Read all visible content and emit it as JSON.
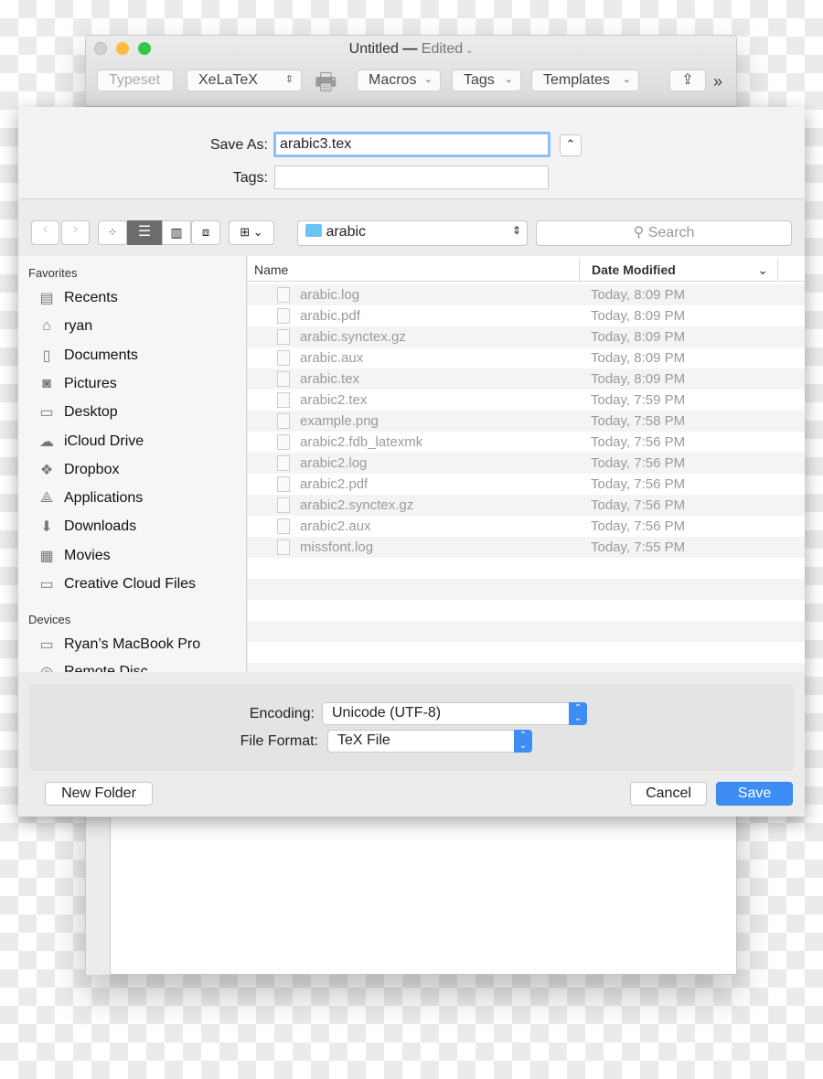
{
  "window": {
    "title": "Untitled",
    "title_sep": "—",
    "edited": "Edited",
    "toolbar": {
      "typeset": "Typeset",
      "engine": "XeLaTeX",
      "macros": "Macros",
      "tags": "Tags",
      "templates": "Templates",
      "overflow": "»"
    }
  },
  "dialog": {
    "save_as_label": "Save As:",
    "save_as_value": "arabic3.tex",
    "tags_label": "Tags:",
    "tags_value": "",
    "location": "arabic",
    "search_placeholder": "Search",
    "sidebar": {
      "favorites_header": "Favorites",
      "favorites": [
        {
          "label": "Recents",
          "icon": "recents-icon"
        },
        {
          "label": "ryan",
          "icon": "home-icon"
        },
        {
          "label": "Documents",
          "icon": "documents-icon"
        },
        {
          "label": "Pictures",
          "icon": "camera-icon"
        },
        {
          "label": "Desktop",
          "icon": "desktop-icon"
        },
        {
          "label": "iCloud Drive",
          "icon": "cloud-icon"
        },
        {
          "label": "Dropbox",
          "icon": "dropbox-icon"
        },
        {
          "label": "Applications",
          "icon": "applications-icon"
        },
        {
          "label": "Downloads",
          "icon": "downloads-icon"
        },
        {
          "label": "Movies",
          "icon": "movies-icon"
        },
        {
          "label": "Creative Cloud Files",
          "icon": "folder-icon"
        }
      ],
      "devices_header": "Devices",
      "devices": [
        {
          "label": "Ryan’s MacBook Pro",
          "icon": "laptop-icon"
        },
        {
          "label": "Remote Disc",
          "icon": "disc-icon"
        }
      ]
    },
    "columns": {
      "name": "Name",
      "date": "Date Modified"
    },
    "files": [
      {
        "name": "arabic.log",
        "date": "Today, 8:09 PM"
      },
      {
        "name": "arabic.pdf",
        "date": "Today, 8:09 PM"
      },
      {
        "name": "arabic.synctex.gz",
        "date": "Today, 8:09 PM"
      },
      {
        "name": "arabic.aux",
        "date": "Today, 8:09 PM"
      },
      {
        "name": "arabic.tex",
        "date": "Today, 8:09 PM"
      },
      {
        "name": "arabic2.tex",
        "date": "Today, 7:59 PM"
      },
      {
        "name": "example.png",
        "date": "Today, 7:58 PM"
      },
      {
        "name": "arabic2.fdb_latexmk",
        "date": "Today, 7:56 PM"
      },
      {
        "name": "arabic2.log",
        "date": "Today, 7:56 PM"
      },
      {
        "name": "arabic2.pdf",
        "date": "Today, 7:56 PM"
      },
      {
        "name": "arabic2.synctex.gz",
        "date": "Today, 7:56 PM"
      },
      {
        "name": "arabic2.aux",
        "date": "Today, 7:56 PM"
      },
      {
        "name": "missfont.log",
        "date": "Today, 7:55 PM"
      }
    ],
    "encoding_label": "Encoding:",
    "encoding_value": "Unicode (UTF-8)",
    "format_label": "File Format:",
    "format_value": "TeX File",
    "new_folder": "New Folder",
    "cancel": "Cancel",
    "save": "Save"
  },
  "colors": {
    "accent": "#3d8df4",
    "close": "#d0d0d0",
    "minimize": "#fdbc40",
    "zoom": "#34c84a"
  }
}
